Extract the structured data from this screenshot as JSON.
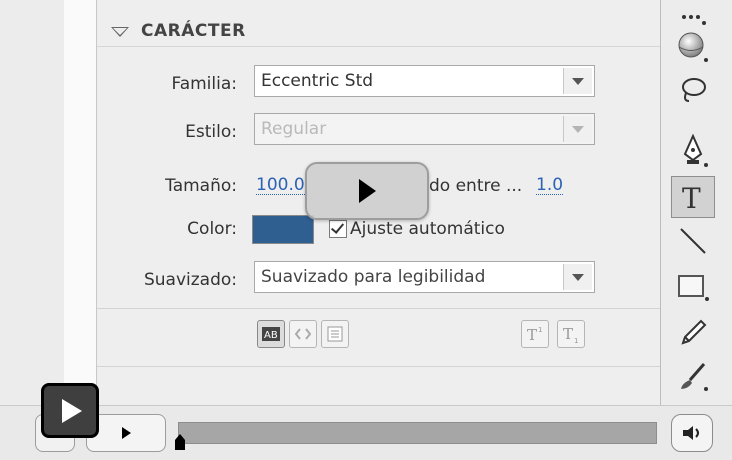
{
  "panel": {
    "section_title": "CARÁCTER",
    "familia_label": "Familia:",
    "familia_value": "Eccentric Std",
    "estilo_label": "Estilo:",
    "estilo_value": "Regular",
    "tamano_label": "Tamaño:",
    "tamano_value": "100.0",
    "spacing_text": "do entre ...",
    "spacing_value": "1.0",
    "color_label": "Color:",
    "color_value": "#2f5e91",
    "autokern_label": "Ajuste automático",
    "autokern_checked": true,
    "suavizado_label": "Suavizado:",
    "suavizado_value": "Suavizado para legibilidad",
    "text_buttons": {
      "selectable_icon": "selectable-text-icon",
      "html_icon": "html-render-icon",
      "border_icon": "text-border-icon",
      "superscript_icon": "superscript-icon",
      "subscript_icon": "subscript-icon"
    }
  },
  "toolbar": {
    "tools": [
      "dotted-select-icon",
      "3d-rotation-icon",
      "lasso-icon",
      "pen-icon",
      "text-tool-icon",
      "line-icon",
      "rectangle-icon",
      "pencil-icon",
      "brush-icon"
    ],
    "selected_tool": "text-tool-icon"
  },
  "player": {
    "big_play_icon": "play-icon",
    "progress": 0.0,
    "volume_icon": "speaker-icon"
  }
}
